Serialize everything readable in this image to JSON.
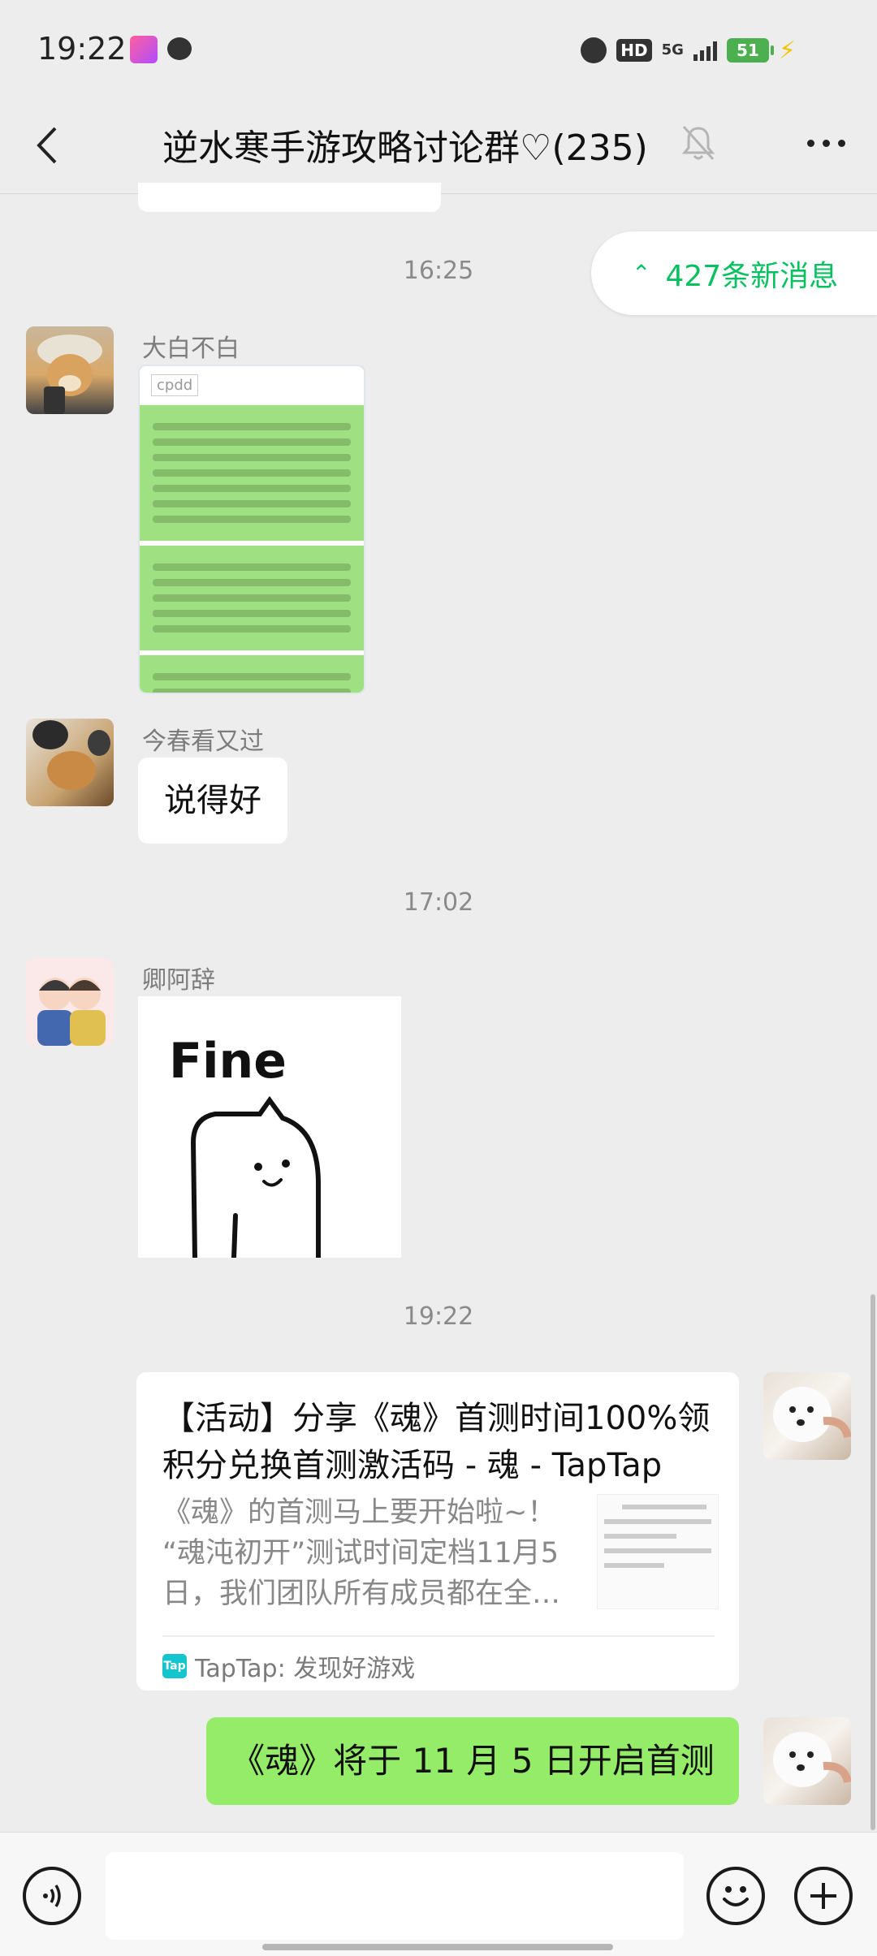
{
  "status_bar": {
    "time": "19:22",
    "network": "5G",
    "hd": "HD",
    "battery": "51"
  },
  "header": {
    "title": "逆水寒手游攻略讨论群♡(235)"
  },
  "new_messages": {
    "label": "427条新消息"
  },
  "timestamps": {
    "t1": "16:25",
    "t2": "17:02",
    "t3": "19:22"
  },
  "messages": {
    "m1": {
      "sender": "大白不白",
      "image_caption": "cpdd"
    },
    "m2": {
      "sender": "今春看又过",
      "text": "说得好"
    },
    "m3": {
      "sender": "卿阿辞",
      "sticker_text": "Fine"
    },
    "m4": {
      "card_title": "【活动】分享《魂》首测时间100%领积分兑换首测激活码 - 魂 - TapTap",
      "card_desc": "《魂》的首测马上要开始啦~！ “魂沌初开”测试时间定档11月5日，我们团队所有成员都在全力准备中",
      "card_source": "TapTap: 发现好游戏",
      "tap_icon": "Tap"
    },
    "m5": {
      "text": "《魂》将于 11 月 5 日开启首测"
    }
  },
  "colors": {
    "accent": "#07c160",
    "own_bubble": "#95ec69",
    "background": "#ededed"
  }
}
